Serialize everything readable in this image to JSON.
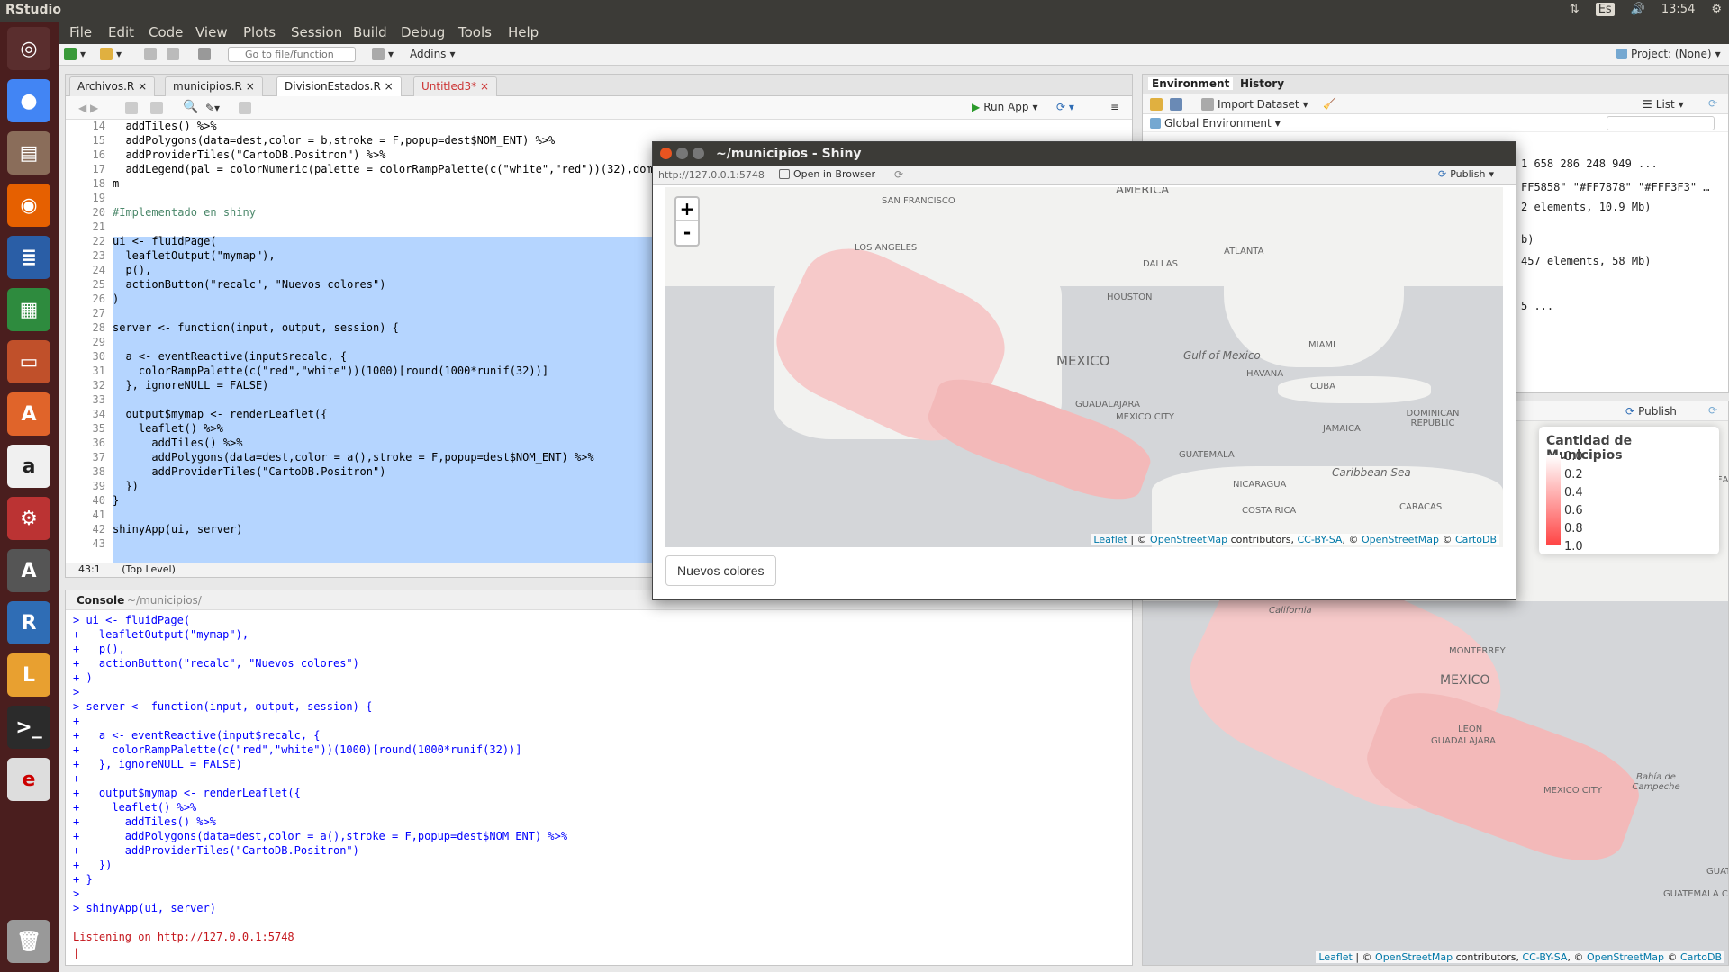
{
  "topbar": {
    "title": "RStudio",
    "lang": "Es",
    "time": "13:54"
  },
  "menu": [
    "File",
    "Edit",
    "Code",
    "View",
    "Plots",
    "Session",
    "Build",
    "Debug",
    "Tools",
    "Help"
  ],
  "toolbar": {
    "goto_placeholder": "Go to file/function",
    "addins": "Addins",
    "project": "Project: (None)"
  },
  "editor": {
    "tabs": [
      "Archivos.R",
      "municipios.R",
      "DivisionEstados.R",
      "Untitled3*"
    ],
    "run_app": "Run App",
    "status_pos": "43:1",
    "status_level": "(Top Level)",
    "lines": [
      {
        "n": "14",
        "t": "  addTiles() %>%"
      },
      {
        "n": "15",
        "t": "  addPolygons(data=dest,color = b,stroke = F,popup=dest$NOM_ENT) %>%"
      },
      {
        "n": "16",
        "t": "  addProviderTiles(\"CartoDB.Positron\") %>%"
      },
      {
        "n": "17",
        "t": "  addLegend(pal = colorNumeric(palette = colorRampPalette(c(\"white\",\"red\"))(32),domain"
      },
      {
        "n": "18",
        "t": "m"
      },
      {
        "n": "19",
        "t": ""
      },
      {
        "n": "20",
        "t": "#Implementado en shiny"
      },
      {
        "n": "21",
        "t": ""
      },
      {
        "n": "22",
        "t": "ui <- fluidPage("
      },
      {
        "n": "23",
        "t": "  leafletOutput(\"mymap\"),"
      },
      {
        "n": "24",
        "t": "  p(),"
      },
      {
        "n": "25",
        "t": "  actionButton(\"recalc\", \"Nuevos colores\")"
      },
      {
        "n": "26",
        "t": ")"
      },
      {
        "n": "27",
        "t": ""
      },
      {
        "n": "28",
        "t": "server <- function(input, output, session) {"
      },
      {
        "n": "29",
        "t": ""
      },
      {
        "n": "30",
        "t": "  a <- eventReactive(input$recalc, {"
      },
      {
        "n": "31",
        "t": "    colorRampPalette(c(\"red\",\"white\"))(1000)[round(1000*runif(32))]"
      },
      {
        "n": "32",
        "t": "  }, ignoreNULL = FALSE)"
      },
      {
        "n": "33",
        "t": ""
      },
      {
        "n": "34",
        "t": "  output$mymap <- renderLeaflet({"
      },
      {
        "n": "35",
        "t": "    leaflet() %>%"
      },
      {
        "n": "36",
        "t": "      addTiles() %>%"
      },
      {
        "n": "37",
        "t": "      addPolygons(data=dest,color = a(),stroke = F,popup=dest$NOM_ENT) %>%"
      },
      {
        "n": "38",
        "t": "      addProviderTiles(\"CartoDB.Positron\")"
      },
      {
        "n": "39",
        "t": "  })"
      },
      {
        "n": "40",
        "t": "}"
      },
      {
        "n": "41",
        "t": ""
      },
      {
        "n": "42",
        "t": "shinyApp(ui, server)"
      },
      {
        "n": "43",
        "t": ""
      }
    ]
  },
  "console": {
    "title": "Console",
    "path": "~/municipios/",
    "lines": [
      "> ui <- fluidPage(",
      "+   leafletOutput(\"mymap\"),",
      "+   p(),",
      "+   actionButton(\"recalc\", \"Nuevos colores\")",
      "+ )",
      ">",
      "> server <- function(input, output, session) {",
      "+",
      "+   a <- eventReactive(input$recalc, {",
      "+     colorRampPalette(c(\"red\",\"white\"))(1000)[round(1000*runif(32))]",
      "+   }, ignoreNULL = FALSE)",
      "+",
      "+   output$mymap <- renderLeaflet({",
      "+     leaflet() %>%",
      "+       addTiles() %>%",
      "+       addPolygons(data=dest,color = a(),stroke = F,popup=dest$NOM_ENT) %>%",
      "+       addProviderTiles(\"CartoDB.Positron\")",
      "+   })",
      "+ }",
      ">",
      "> shinyApp(ui, server)",
      ""
    ],
    "listening": "Listening on http://127.0.0.1:5748"
  },
  "env": {
    "tab_env": "Environment",
    "tab_history": "History",
    "import": "Import Dataset",
    "list": "List",
    "global": "Global Environment",
    "rows": [
      "1 658 286 248 949 ...",
      "FF5858\" \"#FF7878\" \"#FFF3F3\" …",
      "2 elements, 10.9 Mb)",
      "b)",
      "457 elements, 58 Mb)",
      "5 ..."
    ]
  },
  "viewer": {
    "publish": "Publish",
    "legend_title": "Cantidad de Municipios",
    "legend_ticks": [
      "0.0",
      "0.2",
      "0.4",
      "0.6",
      "0.8",
      "1.0"
    ],
    "labels": [
      "California",
      "MONTERREY",
      "MEXICO",
      "LEON",
      "GUADALAJARA",
      "MEXICO CITY",
      "Bahía de Campeche",
      "GUATE",
      "GUATEMALA CITY",
      "NEW ORLEANS"
    ]
  },
  "shiny": {
    "title": "~/municipios - Shiny",
    "url": "http://127.0.0.1:5748",
    "open_browser": "Open in Browser",
    "publish": "Publish",
    "button": "Nuevos colores",
    "labels": [
      "SAN FRANCISCO",
      "LOS ANGELES",
      "DALLAS",
      "ATLANTA",
      "HOUSTON",
      "MIAMI",
      "Gulf of Mexico",
      "MEXICO",
      "HAVANA",
      "CUBA",
      "DOMINICAN REPUBLIC",
      "JAMAICA",
      "GUADALAJARA",
      "MEXICO CITY",
      "GUATEMALA",
      "Caribbean Sea",
      "NICARAGUA",
      "COSTA RICA",
      "CARACAS",
      "AMERICA"
    ]
  },
  "attribution": {
    "leaflet": "Leaflet",
    "osm": "OpenStreetMap",
    "contrib": "contributors,",
    "ccbysa": "CC-BY-SA",
    "cartodb": "CartoDB"
  },
  "colors": {
    "accent": "#75a8d1",
    "selection": "#b5d5ff",
    "launcher": "#4a1e1e",
    "mexico": "#f6c9c9"
  }
}
